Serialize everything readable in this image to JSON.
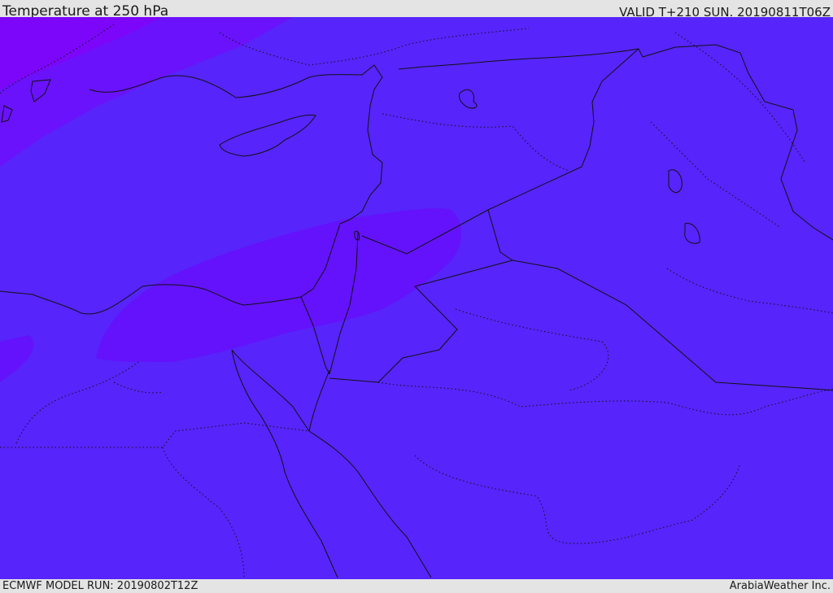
{
  "header": {
    "title": "Temperature at 250 hPa",
    "valid": "VALID T+210 SUN. 20190811T06Z"
  },
  "footer": {
    "model_run": "ECMWF MODEL RUN: 20190802T12Z",
    "credit": "ArabiaWeather Inc."
  },
  "colors": {
    "base": "#5724fb",
    "cold_band_outer": "#6a12fb",
    "cold_band_inner": "#7c06fa",
    "cold_pocket": "#6412fb",
    "border_line": "#111111"
  }
}
